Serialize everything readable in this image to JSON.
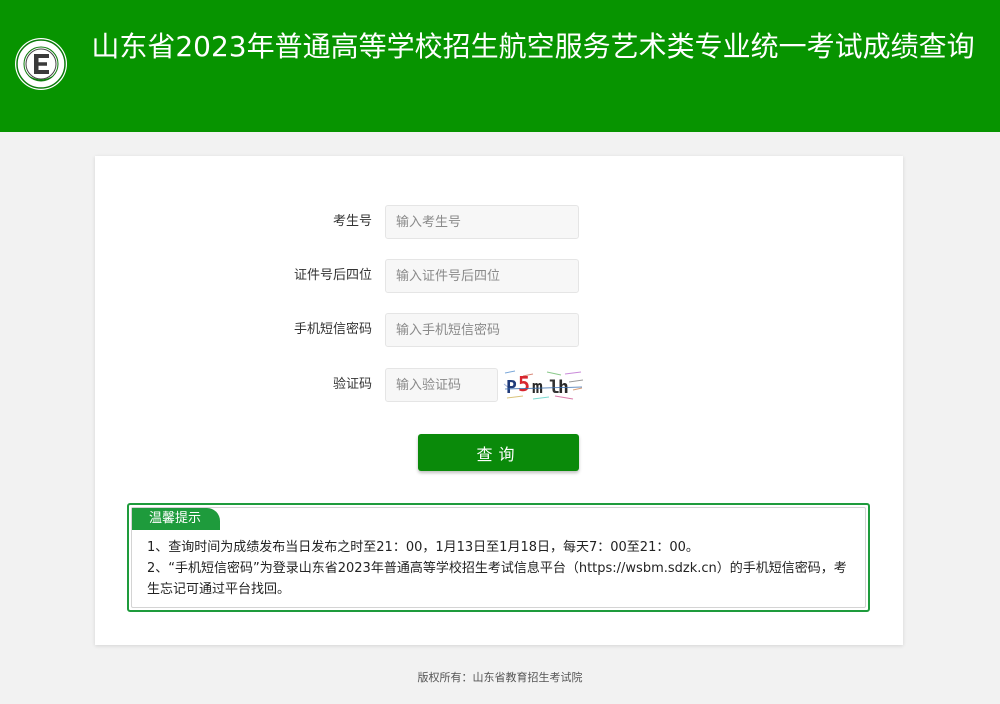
{
  "header": {
    "title": "山东省2023年普通高等学校招生航空服务艺术类专业统一考试成绩查询",
    "brand_color": "#079400"
  },
  "form": {
    "candidate_no": {
      "label": "考生号",
      "placeholder": "输入考生号"
    },
    "id_last4": {
      "label": "证件号后四位",
      "placeholder": "输入证件号后四位"
    },
    "sms_password": {
      "label": "手机短信密码",
      "placeholder": "输入手机短信密码"
    },
    "captcha": {
      "label": "验证码",
      "placeholder": "输入验证码",
      "image_text": "P5mlh"
    },
    "submit_label": "查询"
  },
  "notice": {
    "tag": "温馨提示",
    "items": [
      "1、查询时间为成绩发布当日发布之时至21：00，1月13日至1月18日，每天7：00至21：00。",
      "2、“手机短信密码”为登录山东省2023年普通高等学校招生考试信息平台（https://wsbm.sdzk.cn）的手机短信密码，考生忘记可通过平台找回。"
    ]
  },
  "footer": {
    "copyright": "版权所有：山东省教育招生考试院"
  }
}
